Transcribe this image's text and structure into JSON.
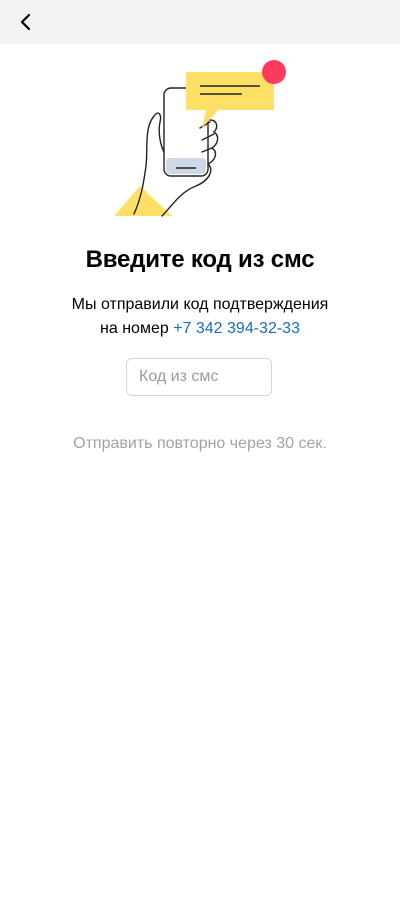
{
  "header": {
    "back_icon": "chevron-left-icon"
  },
  "illustration": {
    "icon": "sms-phone-illustration",
    "colors": {
      "bubble": "#ffe066",
      "badge": "#ff3b5c",
      "accent": "#ffe066",
      "phone_screen": "#cfd8e6"
    }
  },
  "main": {
    "title": "Введите код из смс",
    "subtitle_line1": "Мы отправили код подтверждения",
    "subtitle_line2_prefix": "на номер",
    "phone_number": "+7 342 394-32-33",
    "code_input": {
      "value": "",
      "placeholder": "Код из смс"
    },
    "resend_text": "Отправить повторно через 30 сек."
  },
  "colors": {
    "link": "#1b6ac0",
    "muted": "#a3a3a3",
    "topbar_bg": "#f2f2f2"
  }
}
